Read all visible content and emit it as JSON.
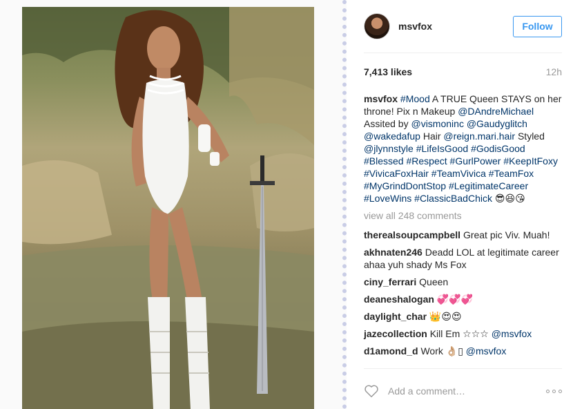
{
  "post": {
    "username": "msvfox",
    "follow_label": "Follow",
    "likes": "7,413 likes",
    "time": "12h"
  },
  "caption": {
    "username": "msvfox",
    "parts": [
      {
        "t": "#Mood",
        "tag": true
      },
      {
        "t": " A TRUE Queen STAYS on her throne! Pix n Makeup ",
        "tag": false
      },
      {
        "t": "@DAndreMichael",
        "tag": true
      },
      {
        "t": " Assited by ",
        "tag": false
      },
      {
        "t": "@vismoninc",
        "tag": true
      },
      {
        "t": " ",
        "tag": false
      },
      {
        "t": "@Gaudyglitch",
        "tag": true
      },
      {
        "t": " ",
        "tag": false
      },
      {
        "t": "@wakedafup",
        "tag": true
      },
      {
        "t": " Hair ",
        "tag": false
      },
      {
        "t": "@reign.mari.hair",
        "tag": true
      },
      {
        "t": " Styled ",
        "tag": false
      },
      {
        "t": "@jlynnstyle",
        "tag": true
      },
      {
        "t": " ",
        "tag": false
      },
      {
        "t": "#LifeIsGood",
        "tag": true
      },
      {
        "t": " ",
        "tag": false
      },
      {
        "t": "#GodisGood",
        "tag": true
      },
      {
        "t": " ",
        "tag": false
      },
      {
        "t": "#Blessed",
        "tag": true
      },
      {
        "t": " ",
        "tag": false
      },
      {
        "t": "#Respect",
        "tag": true
      },
      {
        "t": " ",
        "tag": false
      },
      {
        "t": "#GurlPower",
        "tag": true
      },
      {
        "t": " ",
        "tag": false
      },
      {
        "t": "#KeepItFoxy",
        "tag": true
      },
      {
        "t": " ",
        "tag": false
      },
      {
        "t": "#VivicaFoxHair",
        "tag": true
      },
      {
        "t": " ",
        "tag": false
      },
      {
        "t": "#TeamVivica",
        "tag": true
      },
      {
        "t": " ",
        "tag": false
      },
      {
        "t": "#TeamFox",
        "tag": true
      },
      {
        "t": " ",
        "tag": false
      },
      {
        "t": "#MyGrindDontStop",
        "tag": true
      },
      {
        "t": " ",
        "tag": false
      },
      {
        "t": "#LegitimateCareer",
        "tag": true
      },
      {
        "t": " ",
        "tag": false
      },
      {
        "t": "#LoveWins",
        "tag": true
      },
      {
        "t": " ",
        "tag": false
      },
      {
        "t": "#ClassicBadChick",
        "tag": true
      },
      {
        "t": " 😎😆😘",
        "tag": false
      }
    ]
  },
  "view_all": "view all 248 comments",
  "comments": [
    {
      "user": "therealsoupcampbell",
      "text": "Great pic Viv. Muah!",
      "mention": ""
    },
    {
      "user": "akhnaten246",
      "text": "Deadd LOL at legitimate career ahaa yuh shady Ms Fox",
      "mention": ""
    },
    {
      "user": "ciny_ferrari",
      "text": "Queen",
      "mention": ""
    },
    {
      "user": "deaneshalogan",
      "text": "💞💞💞",
      "mention": ""
    },
    {
      "user": "daylight_char",
      "text": "👑😍😍",
      "mention": ""
    },
    {
      "user": "jazecollection",
      "text": "Kill Em ☆☆☆",
      "mention": "@msvfox"
    },
    {
      "user": "d1amond_d",
      "text": "Work 👌🏼▯",
      "mention": "@msvfox"
    }
  ],
  "footer": {
    "add_comment_placeholder": "Add a comment…",
    "heart_icon": "heart-icon",
    "more_icon": "more-options-icon"
  },
  "colors": {
    "accent": "#3897f0",
    "tag": "#003569",
    "muted": "#999999"
  }
}
